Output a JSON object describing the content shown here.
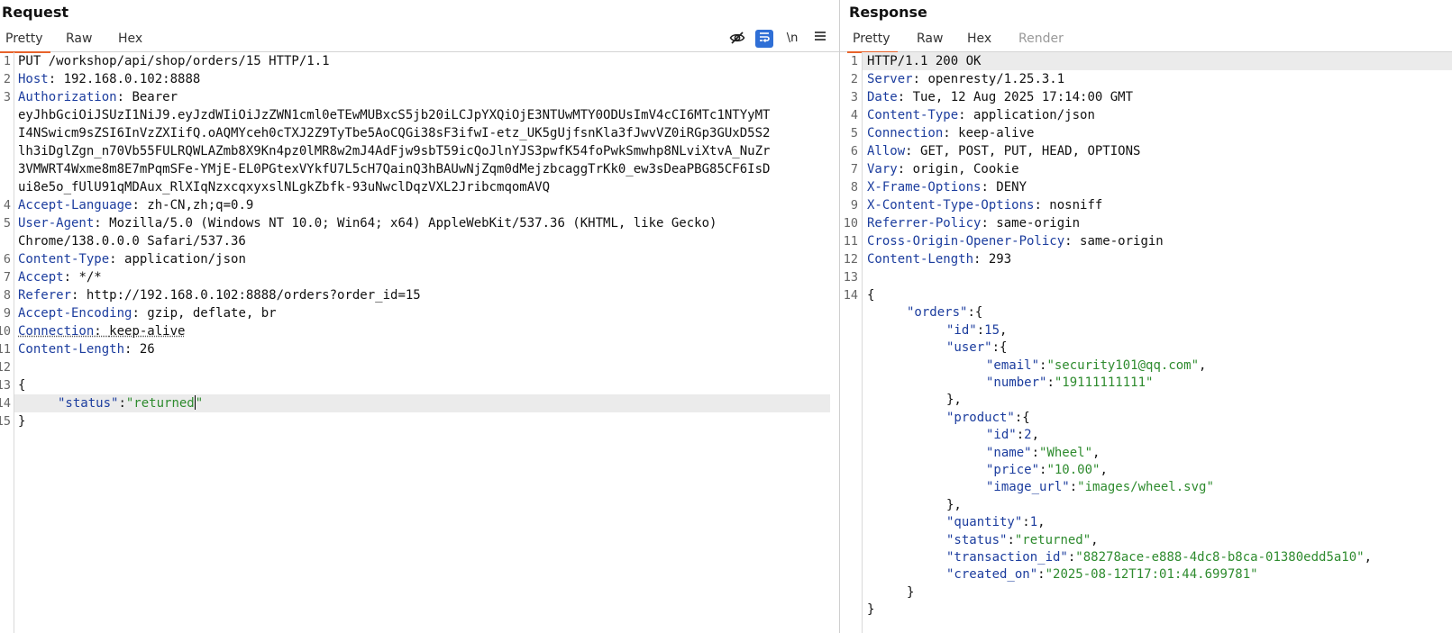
{
  "request": {
    "title": "Request",
    "tabs": [
      "Pretty",
      "Raw",
      "Hex"
    ],
    "toolbar": {
      "hide_icon": "eye-slash-icon",
      "wrap_icon": "word-wrap-icon",
      "newline_label": "\\n",
      "menu_icon": "hamburger-menu-icon"
    },
    "line_numbers": [
      "1",
      "2",
      "3",
      "4",
      "5",
      "6",
      "7",
      "8",
      "9",
      "10",
      "11",
      "12",
      "13",
      "14",
      "15"
    ],
    "request_line": "PUT /workshop/api/shop/orders/15 HTTP/1.1",
    "headers": [
      {
        "name": "Host",
        "value": "192.168.0.102:8888"
      },
      {
        "name": "Authorization",
        "value": "Bearer"
      },
      {
        "name": "Accept-Language",
        "value": "zh-CN,zh;q=0.9"
      },
      {
        "name": "User-Agent",
        "value": "Mozilla/5.0 (Windows NT 10.0; Win64; x64) AppleWebKit/537.36 (KHTML, like Gecko)"
      },
      {
        "name": "Content-Type",
        "value": "application/json"
      },
      {
        "name": "Accept",
        "value": "*/*"
      },
      {
        "name": "Referer",
        "value": "http://192.168.0.102:8888/orders?order_id=15"
      },
      {
        "name": "Accept-Encoding",
        "value": "gzip, deflate, br"
      },
      {
        "name": "Connection",
        "value": "keep-alive"
      },
      {
        "name": "Content-Length",
        "value": "26"
      }
    ],
    "token_lines": [
      "eyJhbGciOiJSUzI1NiJ9.eyJzdWIiOiJzZWN1cml0eTEwMUBxcS5jb20iLCJpYXQiOjE3NTUwMTY0ODUsImV4cCI6MTc1NTYyMT",
      "I4NSwicm9sZSI6InVzZXIifQ.oAQMYceh0cTXJ2Z9TyTbe5AoCQGi38sF3ifwI-etz_UK5gUjfsnKla3fJwvVZ0iRGp3GUxD5S2",
      "lh3iDglZgn_n70Vb55FULRQWLAZmb8X9Kn4pz0lMR8w2mJ4AdFjw9sbT59icQoJlnYJS3pwfK54foPwkSmwhp8NLviXtvA_NuZr",
      "3VMWRT4Wxme8m8E7mPqmSFe-YMjE-EL0PGtexVYkfU7L5cH7QainQ3hBAUwNjZqm0dMejzbcaggTrKk0_ew3sDeaPBG85CF6IsD",
      "ui8e5o_fUlU91qMDAux_RlXIqNzxcqxyxslNLgkZbfk-93uNwclDqzVXL2JribcmqomAVQ"
    ],
    "ua_cont": "Chrome/138.0.0.0 Safari/537.36",
    "body_open": "{",
    "body_key": "\"status\"",
    "body_colon": ":",
    "body_value": "\"returned",
    "body_value_end": "\"",
    "body_close": "}"
  },
  "response": {
    "title": "Response",
    "tabs": [
      "Pretty",
      "Raw",
      "Hex",
      "Render"
    ],
    "line_numbers": [
      "1",
      "2",
      "3",
      "4",
      "5",
      "6",
      "7",
      "8",
      "9",
      "10",
      "11",
      "12",
      "13",
      "14"
    ],
    "status_line": "HTTP/1.1 200 OK",
    "headers": [
      {
        "name": "Server",
        "value": "openresty/1.25.3.1"
      },
      {
        "name": "Date",
        "value": "Tue, 12 Aug 2025 17:14:00 GMT"
      },
      {
        "name": "Content-Type",
        "value": "application/json"
      },
      {
        "name": "Connection",
        "value": "keep-alive"
      },
      {
        "name": "Allow",
        "value": "GET, POST, PUT, HEAD, OPTIONS"
      },
      {
        "name": "Vary",
        "value": "origin, Cookie"
      },
      {
        "name": "X-Frame-Options",
        "value": "DENY"
      },
      {
        "name": "X-Content-Type-Options",
        "value": "nosniff"
      },
      {
        "name": "Referrer-Policy",
        "value": "same-origin"
      },
      {
        "name": "Cross-Origin-Opener-Policy",
        "value": "same-origin"
      },
      {
        "name": "Content-Length",
        "value": "293"
      }
    ],
    "json_lines": [
      {
        "indent": 0,
        "parts": [
          [
            "p",
            "{"
          ]
        ]
      },
      {
        "indent": 1,
        "parts": [
          [
            "k",
            "\"orders\""
          ],
          [
            "p",
            ":{"
          ]
        ]
      },
      {
        "indent": 2,
        "parts": [
          [
            "k",
            "\"id\""
          ],
          [
            "p",
            ":"
          ],
          [
            "n",
            "15"
          ],
          [
            "p",
            ","
          ]
        ]
      },
      {
        "indent": 2,
        "parts": [
          [
            "k",
            "\"user\""
          ],
          [
            "p",
            ":{"
          ]
        ]
      },
      {
        "indent": 3,
        "parts": [
          [
            "k",
            "\"email\""
          ],
          [
            "p",
            ":"
          ],
          [
            "s",
            "\"security101@qq.com\""
          ],
          [
            "p",
            ","
          ]
        ]
      },
      {
        "indent": 3,
        "parts": [
          [
            "k",
            "\"number\""
          ],
          [
            "p",
            ":"
          ],
          [
            "s",
            "\"19111111111\""
          ]
        ]
      },
      {
        "indent": 2,
        "parts": [
          [
            "p",
            "},"
          ]
        ]
      },
      {
        "indent": 2,
        "parts": [
          [
            "k",
            "\"product\""
          ],
          [
            "p",
            ":{"
          ]
        ]
      },
      {
        "indent": 3,
        "parts": [
          [
            "k",
            "\"id\""
          ],
          [
            "p",
            ":"
          ],
          [
            "n",
            "2"
          ],
          [
            "p",
            ","
          ]
        ]
      },
      {
        "indent": 3,
        "parts": [
          [
            "k",
            "\"name\""
          ],
          [
            "p",
            ":"
          ],
          [
            "s",
            "\"Wheel\""
          ],
          [
            "p",
            ","
          ]
        ]
      },
      {
        "indent": 3,
        "parts": [
          [
            "k",
            "\"price\""
          ],
          [
            "p",
            ":"
          ],
          [
            "s",
            "\"10.00\""
          ],
          [
            "p",
            ","
          ]
        ]
      },
      {
        "indent": 3,
        "parts": [
          [
            "k",
            "\"image_url\""
          ],
          [
            "p",
            ":"
          ],
          [
            "s",
            "\"images/wheel.svg\""
          ]
        ]
      },
      {
        "indent": 2,
        "parts": [
          [
            "p",
            "},"
          ]
        ]
      },
      {
        "indent": 2,
        "parts": [
          [
            "k",
            "\"quantity\""
          ],
          [
            "p",
            ":"
          ],
          [
            "n",
            "1"
          ],
          [
            "p",
            ","
          ]
        ]
      },
      {
        "indent": 2,
        "parts": [
          [
            "k",
            "\"status\""
          ],
          [
            "p",
            ":"
          ],
          [
            "s",
            "\"returned\""
          ],
          [
            "p",
            ","
          ]
        ]
      },
      {
        "indent": 2,
        "parts": [
          [
            "k",
            "\"transaction_id\""
          ],
          [
            "p",
            ":"
          ],
          [
            "s",
            "\"88278ace-e888-4dc8-b8ca-01380edd5a10\""
          ],
          [
            "p",
            ","
          ]
        ]
      },
      {
        "indent": 2,
        "parts": [
          [
            "k",
            "\"created_on\""
          ],
          [
            "p",
            ":"
          ],
          [
            "s",
            "\"2025-08-12T17:01:44.699781\""
          ]
        ]
      },
      {
        "indent": 1,
        "parts": [
          [
            "p",
            "}"
          ]
        ]
      },
      {
        "indent": 0,
        "parts": [
          [
            "p",
            "}"
          ]
        ]
      }
    ]
  }
}
